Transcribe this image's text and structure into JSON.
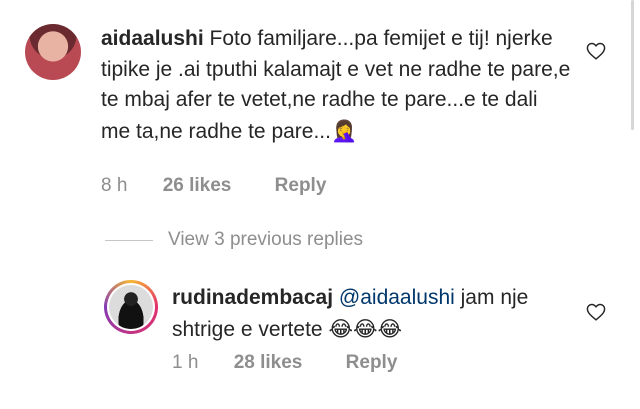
{
  "comment": {
    "username": "aidaalushi",
    "text": "Foto familjare...pa femijet e tij! njerke tipike je .ai tputhi kalamajt e vet ne radhe te pare,e te mbaj afer te vetet,ne radhe te pare...e te dali me ta,ne radhe te pare...",
    "emoji": "🤦‍♀️",
    "time": "8 h",
    "likes": "26 likes",
    "reply_label": "Reply"
  },
  "view_replies": "View 3 previous replies",
  "reply": {
    "username": "rudinadembacaj",
    "mention": "@aidaalushi",
    "text": "jam nje shtrige e vertete",
    "emojis": "😂😂😂",
    "time": "1 h",
    "likes": "28 likes",
    "reply_label": "Reply"
  },
  "icons": {
    "like": "heart-outline-icon"
  },
  "colors": {
    "text": "#262626",
    "secondary": "#8e8e8e",
    "mention": "#00376b"
  }
}
